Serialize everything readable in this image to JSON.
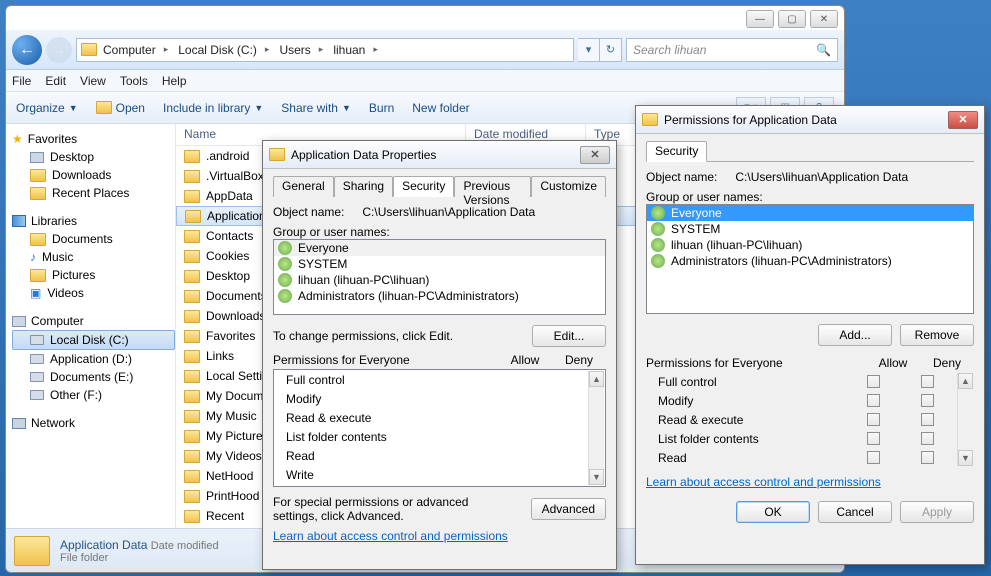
{
  "window_controls": {
    "min": "—",
    "max": "▢",
    "close": "✕"
  },
  "nav": {
    "segments": [
      "Computer",
      "Local Disk (C:)",
      "Users",
      "lihuan"
    ],
    "search_placeholder": "Search lihuan"
  },
  "menu": {
    "file": "File",
    "edit": "Edit",
    "view": "View",
    "tools": "Tools",
    "help": "Help"
  },
  "toolbar": {
    "organize": "Organize",
    "open": "Open",
    "include": "Include in library",
    "share": "Share with",
    "burn": "Burn",
    "newfolder": "New folder"
  },
  "sidebar": {
    "favorites_title": "Favorites",
    "favorites": [
      "Desktop",
      "Downloads",
      "Recent Places"
    ],
    "libraries_title": "Libraries",
    "libraries": [
      "Documents",
      "Music",
      "Pictures",
      "Videos"
    ],
    "computer_title": "Computer",
    "drives": [
      "Local Disk (C:)",
      "Application (D:)",
      "Documents (E:)",
      "Other (F:)"
    ],
    "network_title": "Network"
  },
  "filecols": {
    "name": "Name",
    "date": "Date modified",
    "type": "Type"
  },
  "files": [
    ".android",
    ".VirtualBox",
    "AppData",
    "Application Data",
    "Contacts",
    "Cookies",
    "Desktop",
    "Documents",
    "Downloads",
    "Favorites",
    "Links",
    "Local Settings",
    "My Documents",
    "My Music",
    "My Pictures",
    "My Videos",
    "NetHood",
    "PrintHood",
    "Recent"
  ],
  "selected_file": "Application Data",
  "status": {
    "name": "Application Data",
    "date_label": "Date modified",
    "type": "File folder"
  },
  "props_dialog": {
    "title": "Application Data Properties",
    "tabs": [
      "General",
      "Sharing",
      "Security",
      "Previous Versions",
      "Customize"
    ],
    "active_tab": "Security",
    "object_label": "Object name:",
    "object_value": "C:\\Users\\lihuan\\Application Data",
    "group_label": "Group or user names:",
    "users": [
      "Everyone",
      "SYSTEM",
      "lihuan (lihuan-PC\\lihuan)",
      "Administrators (lihuan-PC\\Administrators)"
    ],
    "change_text": "To change permissions, click Edit.",
    "edit_btn": "Edit...",
    "perm_for": "Permissions for Everyone",
    "allow": "Allow",
    "deny": "Deny",
    "perms": [
      "Full control",
      "Modify",
      "Read & execute",
      "List folder contents",
      "Read",
      "Write"
    ],
    "adv_text": "For special permissions or advanced settings, click Advanced.",
    "adv_btn": "Advanced",
    "link": "Learn about access control and permissions"
  },
  "perms_dialog": {
    "title": "Permissions for Application Data",
    "tab": "Security",
    "object_label": "Object name:",
    "object_value": "C:\\Users\\lihuan\\Application Data",
    "group_label": "Group or user names:",
    "users": [
      "Everyone",
      "SYSTEM",
      "lihuan (lihuan-PC\\lihuan)",
      "Administrators (lihuan-PC\\Administrators)"
    ],
    "add_btn": "Add...",
    "remove_btn": "Remove",
    "perm_for": "Permissions for Everyone",
    "allow": "Allow",
    "deny": "Deny",
    "perms": [
      "Full control",
      "Modify",
      "Read & execute",
      "List folder contents",
      "Read"
    ],
    "link": "Learn about access control and permissions",
    "ok": "OK",
    "cancel": "Cancel",
    "apply": "Apply"
  }
}
